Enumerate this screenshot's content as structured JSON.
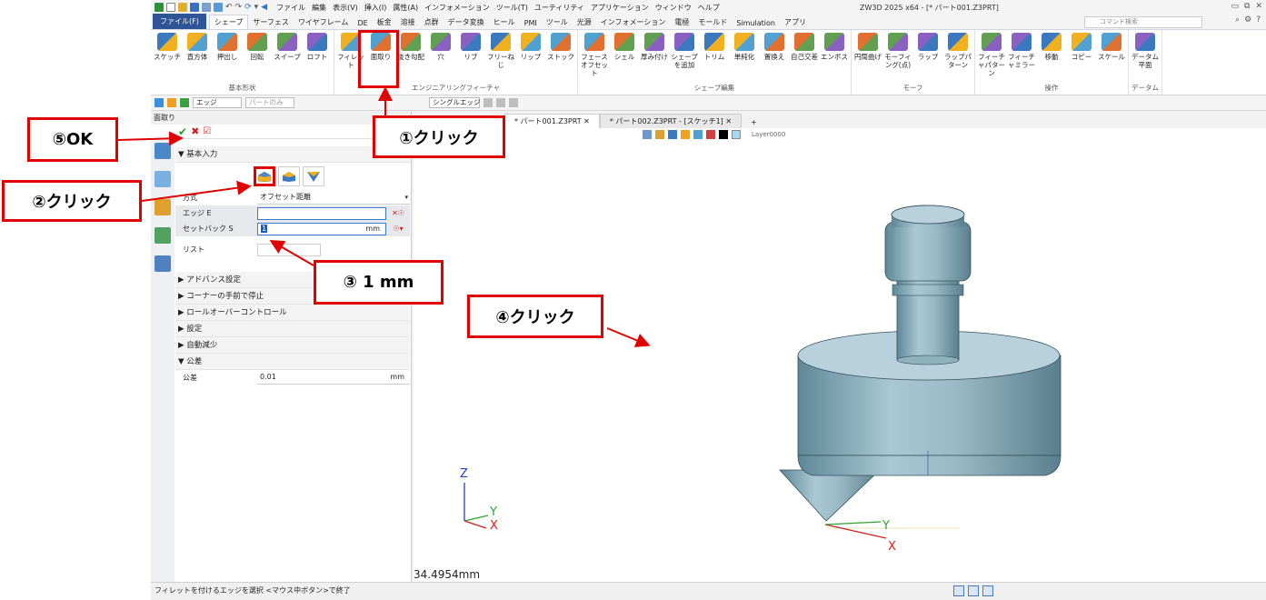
{
  "titlebar": {
    "menus": [
      "ファイル",
      "編集",
      "表示(V)",
      "挿入(I)",
      "属性(A)",
      "インフォメーション",
      "ツール(T)",
      "ユーティリティ",
      "アプリケーション",
      "ウィンドウ",
      "ヘルプ"
    ],
    "window_title": "ZW3D 2025 x64 - [* パート001.Z3PRT]"
  },
  "ribbon_tabs": [
    "ファイル(F)",
    "シェープ",
    "サーフェス",
    "ワイヤフレーム",
    "DE",
    "板金",
    "溶接",
    "点群",
    "データ変換",
    "ヒール",
    "PMI",
    "ツール",
    "光源",
    "インフォメーション",
    "電極",
    "モールド",
    "Simulation",
    "アプリ"
  ],
  "search_placeholder": "コマンド検索",
  "ribbon_groups": [
    {
      "label": "基本形状",
      "buttons": [
        "スケッチ",
        "直方体",
        "押出し",
        "回転",
        "スイープ",
        "ロフト"
      ]
    },
    {
      "label": "エンジニアリングフィーチャ",
      "buttons": [
        "フィレット",
        "面取り",
        "抜き勾配",
        "穴",
        "リブ",
        "フリーねじ",
        "リップ",
        "ストック"
      ]
    },
    {
      "label": "シェープ編集",
      "buttons": [
        "フェースオフセット",
        "シェル",
        "厚み付け",
        "シェープを追加",
        "トリム",
        "単純化",
        "置換え",
        "自己交差",
        "エンボス"
      ]
    },
    {
      "label": "モーフ",
      "buttons": [
        "円筒曲げ",
        "モーフィング(点)",
        "ラップ",
        "ラップパターン"
      ]
    },
    {
      "label": "操作",
      "buttons": [
        "フィーチャパターン",
        "フィーチャミラー",
        "移動",
        "コピー",
        "スケール"
      ]
    },
    {
      "label": "データム",
      "buttons": [
        "データム平面"
      ]
    }
  ],
  "toolbar2": {
    "filter": "エッジ",
    "part_only": "パートのみ",
    "edge_mode": "シングルエッジ"
  },
  "panel": {
    "title": "面取り",
    "basic_input": "▼ 基本入力",
    "method_label": "方式",
    "method_value": "オフセット距離",
    "edge_label": "エッジ E",
    "setback_label": "セットバック S",
    "setback_value": "1",
    "unit": "mm",
    "list_label": "リスト",
    "sections": [
      "▶ アドバンス設定",
      "▶ コーナーの手前で停止",
      "▶ ロールオーバーコントロール",
      "▶ 設定",
      "▶ 自動減少"
    ],
    "tolerance_section": "▼ 公差",
    "tolerance_label": "公差",
    "tolerance_value": "0.01"
  },
  "view_tabs": [
    "* パート001.Z3PRT ✕",
    "* パート002.Z3PRT - [スケッチ1] ✕",
    "+"
  ],
  "layer": "Layer0000",
  "dimension": "34.4954mm",
  "status_text": "フィレットを付けるエッジを選択 <マウス中ボタン>で終了",
  "axis_labels": {
    "z": "Z",
    "y": "Y",
    "x": "X"
  },
  "callouts": {
    "c1": "①クリック",
    "c2": "②クリック",
    "c3": "③ 1 mm",
    "c4": "④クリック",
    "c5": "⑤OK"
  }
}
